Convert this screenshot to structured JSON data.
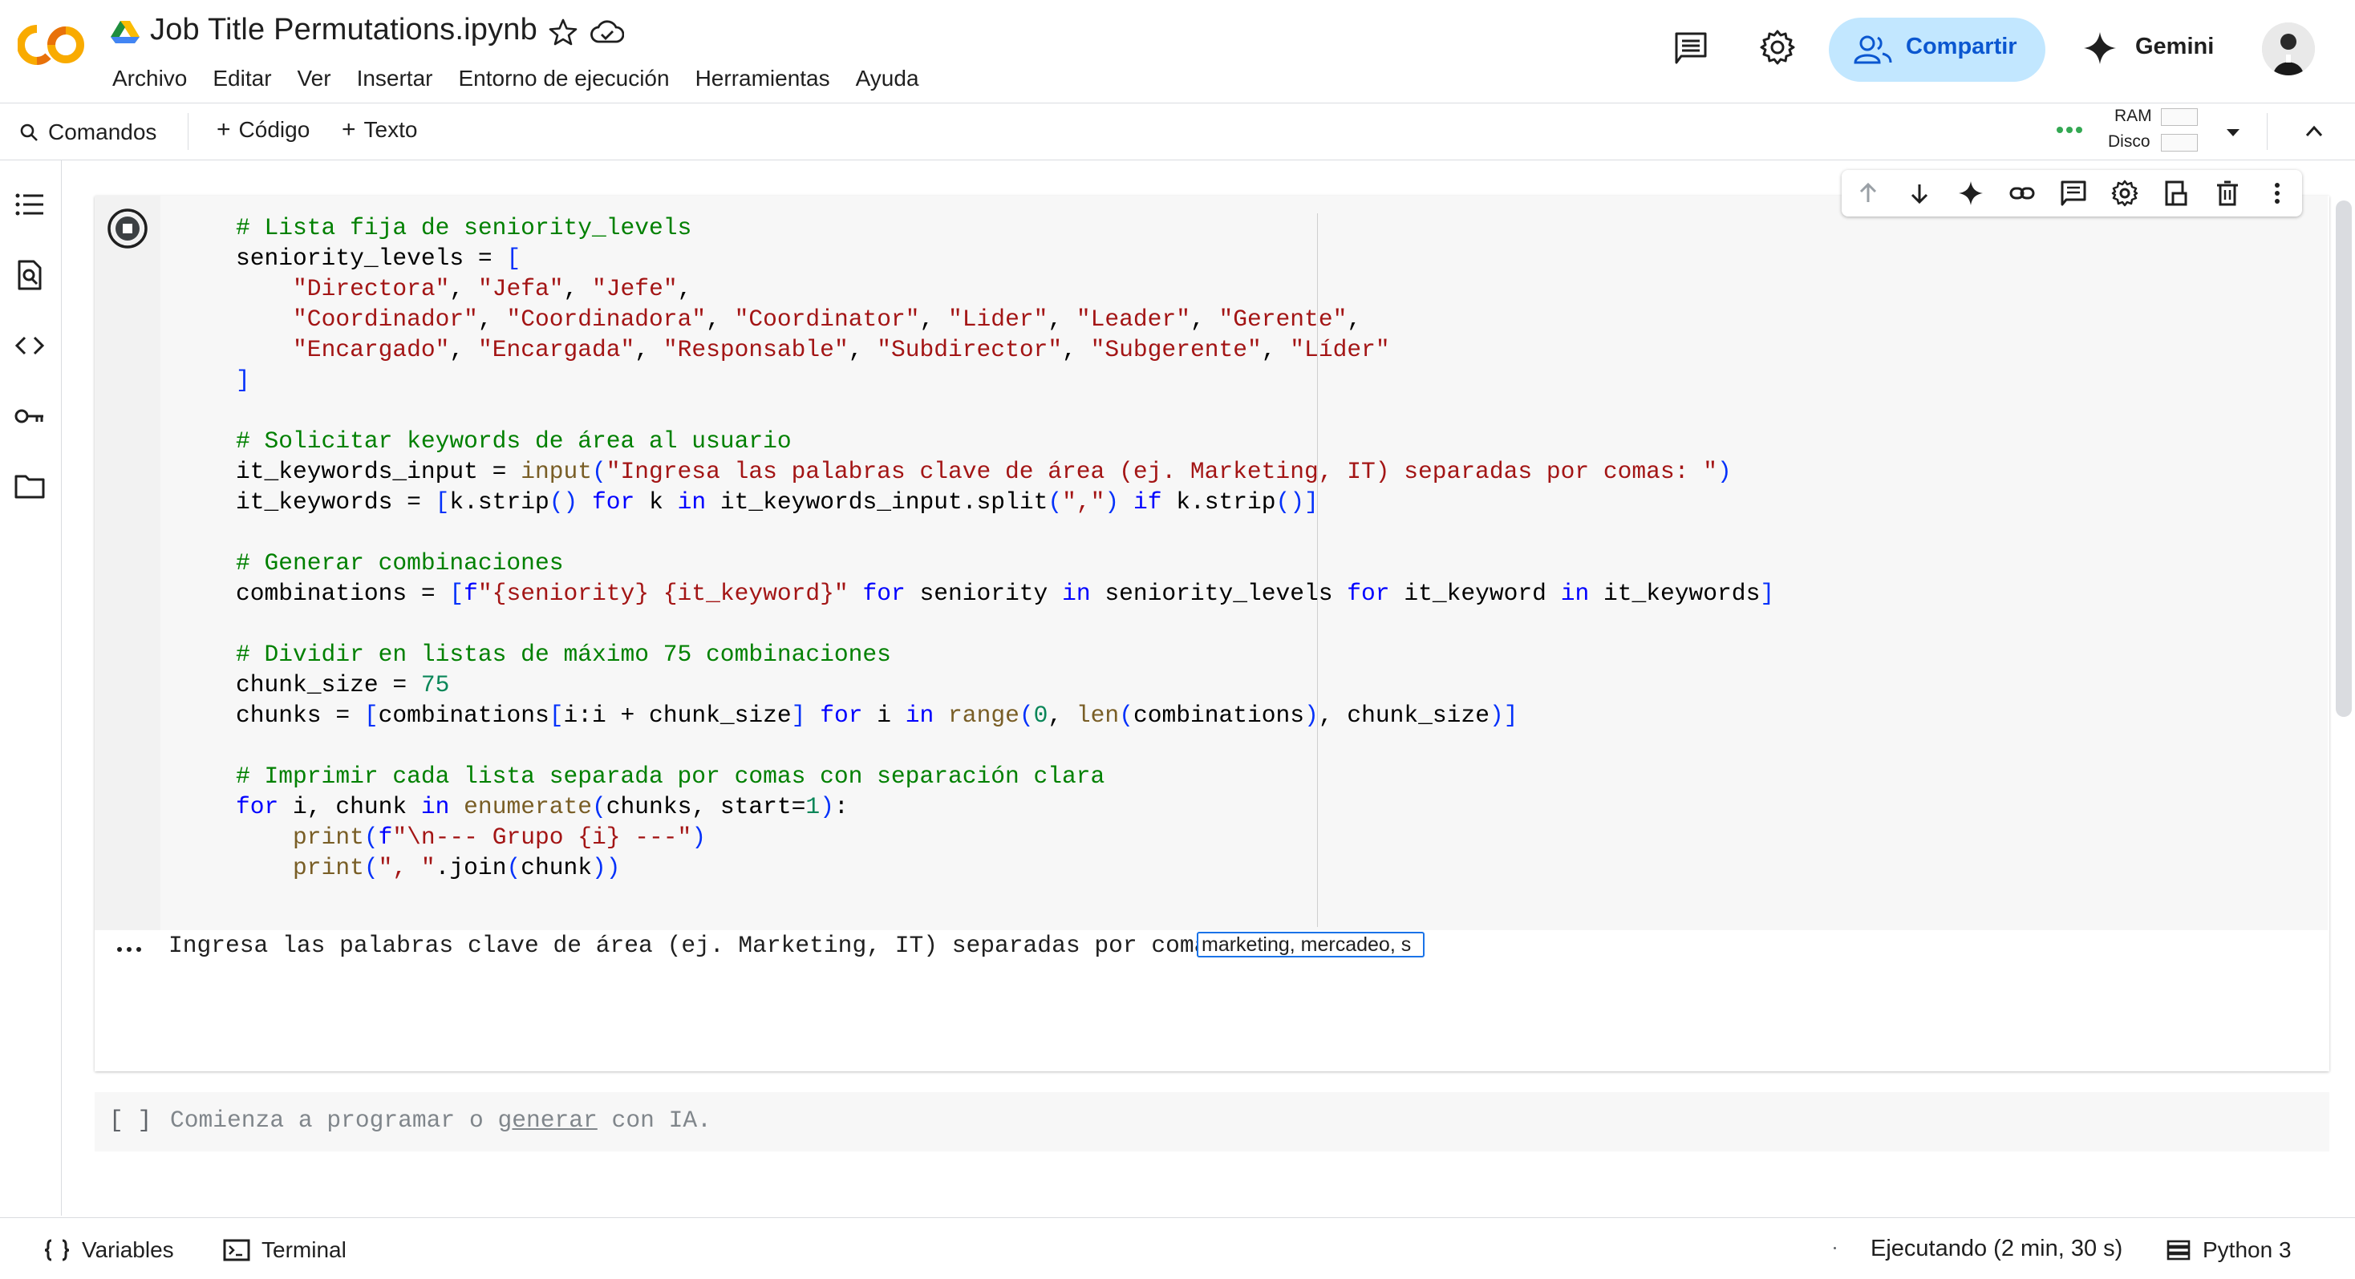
{
  "header": {
    "title": "Job Title Permutations.ipynb",
    "menu": [
      "Archivo",
      "Editar",
      "Ver",
      "Insertar",
      "Entorno de ejecución",
      "Herramientas",
      "Ayuda"
    ],
    "share_label": "Compartir",
    "gemini_label": "Gemini"
  },
  "toolbar": {
    "commands_label": "Comandos",
    "add_code_label": "Código",
    "add_text_label": "Texto",
    "ram_label": "RAM",
    "disk_label": "Disco"
  },
  "cell1": {
    "code_lines": [
      "# Lista fija de seniority_levels",
      "seniority_levels = [",
      "    \"Directora\", \"Jefa\", \"Jefe\",",
      "    \"Coordinador\", \"Coordinadora\", \"Coordinator\", \"Lider\", \"Leader\", \"Gerente\",",
      "    \"Encargado\", \"Encargada\", \"Responsable\", \"Subdirector\", \"Subgerente\", \"Líder\"",
      "]",
      "",
      "# Solicitar keywords de área al usuario",
      "it_keywords_input = input(\"Ingresa las palabras clave de área (ej. Marketing, IT) separadas por comas: \")",
      "it_keywords = [k.strip() for k in it_keywords_input.split(\",\") if k.strip()]",
      "",
      "# Generar combinaciones",
      "combinations = [f\"{seniority} {it_keyword}\" for seniority in seniority_levels for it_keyword in it_keywords]",
      "",
      "# Dividir en listas de máximo 75 combinaciones",
      "chunk_size = 75",
      "chunks = [combinations[i:i + chunk_size] for i in range(0, len(combinations), chunk_size)]",
      "",
      "# Imprimir cada lista separada por comas con separación clara",
      "for i, chunk in enumerate(chunks, start=1):",
      "    print(f\"\\n--- Grupo {i} ---\")",
      "    print(\", \".join(chunk))"
    ],
    "output_prompt": "Ingresa las palabras clave de área (ej. Marketing, IT) separadas por comas: ",
    "input_value": "marketing, mercadeo, s"
  },
  "cell2": {
    "bracket": "[ ]",
    "placeholder_prefix": "Comienza a programar o ",
    "placeholder_link": "generar",
    "placeholder_suffix": " con IA."
  },
  "statusbar": {
    "variables_label": "Variables",
    "terminal_label": "Terminal",
    "status_text": "Ejecutando (2 min, 30 s)",
    "kernel_label": "Python 3"
  },
  "colors": {
    "share_bg": "#c2e7ff",
    "share_fg": "#0b57d0",
    "comment": "#008000",
    "string": "#a31515",
    "keyword": "#0000ff"
  }
}
